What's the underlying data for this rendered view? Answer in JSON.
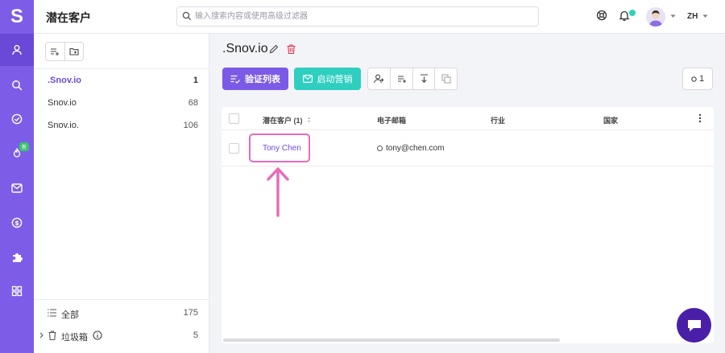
{
  "rail": {
    "logo": "S",
    "items": [
      {
        "icon": "user-icon"
      },
      {
        "icon": "search-icon"
      },
      {
        "icon": "check-circle-icon"
      },
      {
        "icon": "flame-icon",
        "badge": "新"
      },
      {
        "icon": "mail-icon"
      },
      {
        "icon": "dollar-icon"
      },
      {
        "icon": "puzzle-icon"
      },
      {
        "icon": "apps-grid-icon"
      }
    ]
  },
  "header": {
    "title": "潜在客户",
    "search_placeholder": "输入搜索内容或使用高级过滤器",
    "language": "ZH"
  },
  "sidebar": {
    "lists": [
      {
        "name": ".Snov.io",
        "count": "1",
        "active": true
      },
      {
        "name": "Snov.io",
        "count": "68"
      },
      {
        "name": "Snov.io.",
        "count": "106"
      }
    ],
    "all_label": "全部",
    "all_count": "175",
    "trash_label": "垃圾箱",
    "trash_count": "5"
  },
  "main": {
    "list_title": ".Snov.io",
    "verify_label": "验证列表",
    "campaign_label": "启动营销",
    "selected_count": "1"
  },
  "table": {
    "columns": [
      "潜在客户 (1)",
      "电子邮箱",
      "行业",
      "国家"
    ],
    "rows": [
      {
        "name": "Tony Chen",
        "email": "tony@chen.com",
        "industry": "",
        "country": ""
      }
    ]
  },
  "colors": {
    "accent": "#7d5de8",
    "teal": "#2fcfc0",
    "highlight": "#e86bbd"
  }
}
